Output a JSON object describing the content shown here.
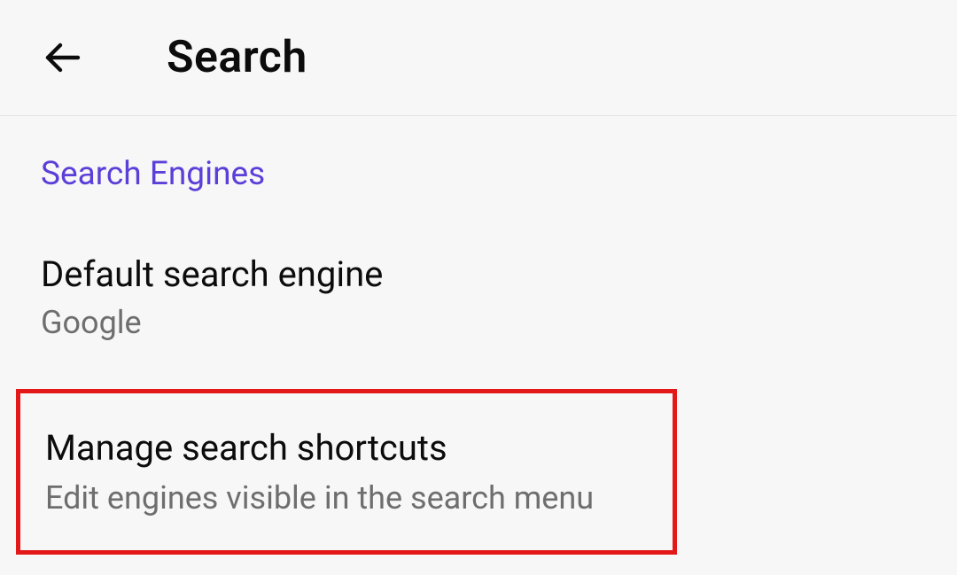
{
  "header": {
    "title": "Search"
  },
  "section": {
    "label": "Search Engines"
  },
  "items": [
    {
      "title": "Default search engine",
      "subtitle": "Google"
    },
    {
      "title": "Manage search shortcuts",
      "subtitle": "Edit engines visible in the search menu"
    }
  ]
}
